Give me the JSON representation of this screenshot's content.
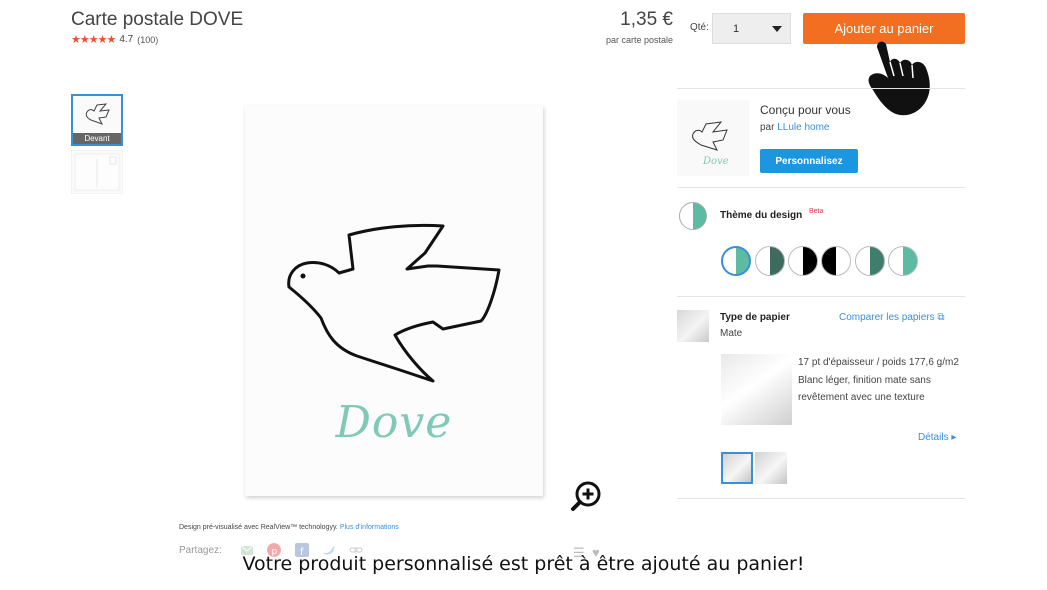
{
  "product": {
    "title": "Carte postale DOVE",
    "stars": "★★★★★",
    "rating": "4.7",
    "review_count": "(100)",
    "price": "1,35 €",
    "price_unit": "par carte postale"
  },
  "order": {
    "qty_label": "Qté:",
    "qty_value": "1",
    "add_to_cart_label": "Ajouter au panier"
  },
  "preview": {
    "thumbnail_front_label": "Devant",
    "card_text": "Dove",
    "realview_text": "Design pré-visualisé avec RealView™ technologyy.",
    "realview_link": "Plus d'informations",
    "share_label": "Partagez:"
  },
  "designer": {
    "title": "Conçu pour vous",
    "by_prefix": "par",
    "by_name": "LLule home",
    "thumb_text": "Dove",
    "personalize_label": "Personnalisez"
  },
  "theme": {
    "title": "Thème du design",
    "beta_badge": "Beta",
    "swatches": [
      {
        "left": "#ffffff",
        "right": "#5dbba3",
        "selected": true
      },
      {
        "left": "#ffffff",
        "right": "#3f6b5f",
        "selected": false
      },
      {
        "left": "#ffffff",
        "right": "#000000",
        "selected": false
      },
      {
        "left": "#000000",
        "right": "#ffffff",
        "selected": false
      },
      {
        "left": "#ffffff",
        "right": "#3f7d6c",
        "selected": false
      },
      {
        "left": "#ffffff",
        "right": "#5dbba3",
        "selected": false
      }
    ]
  },
  "paper": {
    "title": "Type de papier",
    "value": "Mate",
    "compare_label": "Comparer les papiers",
    "description_line1": "17 pt d'épaisseur / poids 177,6 g/m2",
    "description_line2": "Blanc léger, finition mate sans revêtement avec une texture",
    "details_label": "Détails ▸"
  },
  "overlay": {
    "caption": "Votre produit personnalisé est prêt à être ajouté au panier!"
  },
  "colors": {
    "accent_orange": "#f26f21",
    "link_blue": "#3a8fd9",
    "button_blue": "#1d96e0",
    "dove_teal": "#7fcab5"
  }
}
